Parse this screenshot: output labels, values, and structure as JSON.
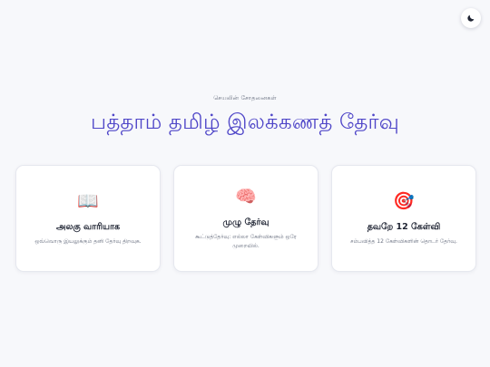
{
  "header": {
    "subtitle": "செயலின் சோதனைகள்",
    "title": "பத்தாம் தமிழ் இலக்கணத் தேர்வு"
  },
  "theme_toggle": {
    "icon": "moon-icon"
  },
  "cards": [
    {
      "icon": "book-icon",
      "glyph": "📖",
      "title": "அலகு வாரியாக",
      "desc": "ஒவ்வொரு இயலுக்கும் தனி தேர்வு திறவுக."
    },
    {
      "icon": "brain-icon",
      "glyph": "🧠",
      "title": "முழு தேர்வு",
      "desc": "கூட்டுத்தேர்வு: எல்லா கேள்விகளும் ஒரே முறையில்."
    },
    {
      "icon": "target-icon",
      "glyph": "🎯",
      "title": "தவறே 12 கேள்வி",
      "desc": "சம்பவித்த 12 கேள்விகளின் தொடர் தேர்வு."
    }
  ],
  "colors": {
    "accent": "#4f46c8",
    "background": "#f7f8fb",
    "card": "#ffffff"
  }
}
